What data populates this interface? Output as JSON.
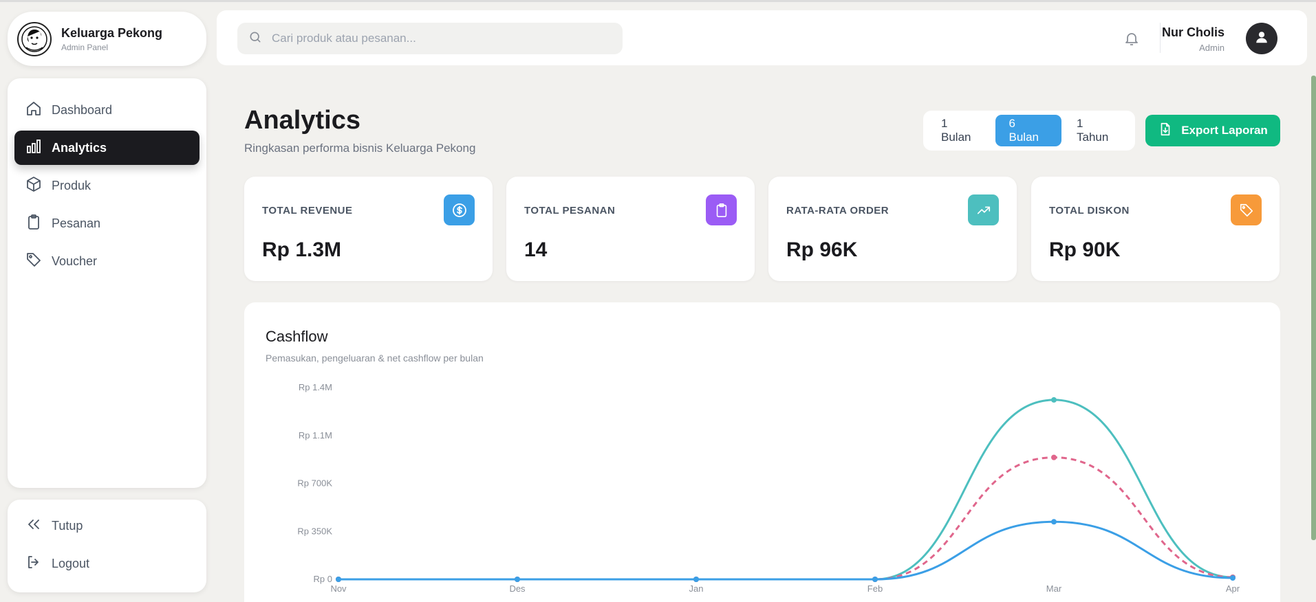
{
  "brand": {
    "name": "Keluarga Pekong",
    "subtitle": "Admin Panel"
  },
  "sidebar": {
    "items": [
      {
        "label": "Dashboard",
        "icon": "home-icon"
      },
      {
        "label": "Analytics",
        "icon": "bar-chart-icon",
        "active": true
      },
      {
        "label": "Produk",
        "icon": "box-icon"
      },
      {
        "label": "Pesanan",
        "icon": "clipboard-icon"
      },
      {
        "label": "Voucher",
        "icon": "tag-icon"
      }
    ],
    "bottom": [
      {
        "label": "Tutup",
        "icon": "chevrons-left-icon"
      },
      {
        "label": "Logout",
        "icon": "logout-icon"
      }
    ]
  },
  "header": {
    "search_placeholder": "Cari produk atau pesanan...",
    "user_name": "Nur Cholis",
    "user_role": "Admin"
  },
  "page": {
    "title": "Analytics",
    "subtitle": "Ringkasan performa bisnis Keluarga Pekong",
    "periods": [
      "1 Bulan",
      "6 Bulan",
      "1 Tahun"
    ],
    "selected_period": "6 Bulan",
    "export_label": "Export Laporan"
  },
  "stats": [
    {
      "label": "TOTAL REVENUE",
      "value": "Rp 1.3M",
      "icon": "dollar-icon",
      "color": "#3b9fe6"
    },
    {
      "label": "TOTAL PESANAN",
      "value": "14",
      "icon": "clipboard-icon",
      "color": "#9b5cf5"
    },
    {
      "label": "RATA-RATA ORDER",
      "value": "Rp 96K",
      "icon": "trending-up-icon",
      "color": "#4dbfbf"
    },
    {
      "label": "TOTAL DISKON",
      "value": "Rp 90K",
      "icon": "tag-icon",
      "color": "#f79a3a"
    }
  ],
  "chart": {
    "title": "Cashflow",
    "subtitle": "Pemasukan, pengeluaran & net cashflow per bulan"
  },
  "chart_data": {
    "type": "line",
    "categories": [
      "Nov",
      "Des",
      "Jan",
      "Feb",
      "Mar",
      "Apr"
    ],
    "y_ticks": [
      "Rp 0",
      "Rp 350K",
      "Rp 700K",
      "Rp 1.1M",
      "Rp 1.4M"
    ],
    "y_tick_values": [
      0,
      350000,
      700000,
      1050000,
      1400000
    ],
    "ylim": [
      0,
      1400000
    ],
    "series": [
      {
        "values": [
          0,
          0,
          0,
          0,
          1310000,
          15000
        ],
        "color": "#4dbfbf",
        "style": "solid"
      },
      {
        "values": [
          0,
          0,
          0,
          0,
          890000,
          15000
        ],
        "color": "#e0668c",
        "style": "dashed"
      },
      {
        "values": [
          0,
          0,
          0,
          0,
          420000,
          10000
        ],
        "color": "#3b9fe6",
        "style": "solid"
      }
    ]
  }
}
